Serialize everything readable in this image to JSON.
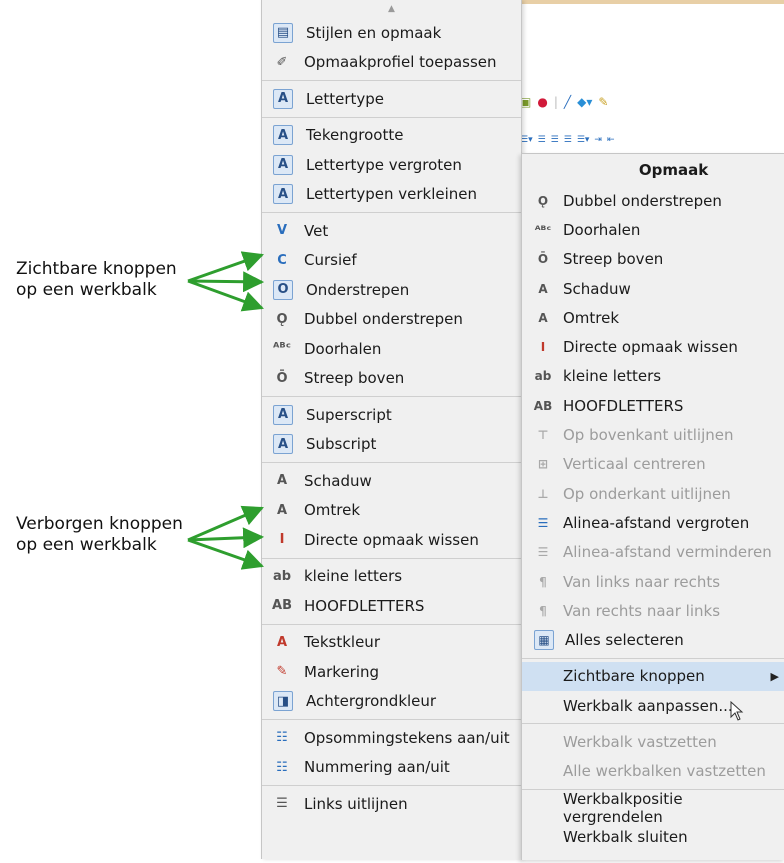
{
  "annotations": {
    "visible_line1": "Zichtbare knoppen",
    "visible_line2": "op een werkbalk",
    "hidden_line1": "Verborgen knoppen",
    "hidden_line2": "op een werkbalk"
  },
  "colors": {
    "arrow": "#2e9e2e",
    "highlight": "#cfe0f2",
    "disabled": "#9c9c9c"
  },
  "left_menu": {
    "groups": [
      [
        {
          "label": "Stijlen en opmaak",
          "icon": "styles-icon"
        },
        {
          "label": "Opmaakprofiel toepassen",
          "icon": "paintbrush-icon"
        }
      ],
      [
        {
          "label": "Lettertype",
          "icon": "font-name-icon"
        }
      ],
      [
        {
          "label": "Tekengrootte",
          "icon": "font-size-icon"
        },
        {
          "label": "Lettertype vergroten",
          "icon": "grow-font-icon"
        },
        {
          "label": "Lettertypen verkleinen",
          "icon": "shrink-font-icon"
        }
      ],
      [
        {
          "label": "Vet",
          "icon": "bold-icon"
        },
        {
          "label": "Cursief",
          "icon": "italic-icon"
        },
        {
          "label": "Onderstrepen",
          "icon": "underline-icon"
        },
        {
          "label": "Dubbel onderstrepen",
          "icon": "double-underline-icon"
        },
        {
          "label": "Doorhalen",
          "icon": "strikethrough-icon"
        },
        {
          "label": "Streep boven",
          "icon": "overline-icon"
        }
      ],
      [
        {
          "label": "Superscript",
          "icon": "superscript-icon"
        },
        {
          "label": "Subscript",
          "icon": "subscript-icon"
        }
      ],
      [
        {
          "label": "Schaduw",
          "icon": "shadow-icon"
        },
        {
          "label": "Omtrek",
          "icon": "outline-icon"
        },
        {
          "label": "Directe opmaak wissen",
          "icon": "clear-formatting-icon"
        }
      ],
      [
        {
          "label": "kleine letters",
          "icon": "lowercase-icon"
        },
        {
          "label": "HOOFDLETTERS",
          "icon": "uppercase-icon"
        }
      ],
      [
        {
          "label": "Tekstkleur",
          "icon": "font-color-icon"
        },
        {
          "label": "Markering",
          "icon": "highlight-icon"
        },
        {
          "label": "Achtergrondkleur",
          "icon": "background-color-icon"
        }
      ],
      [
        {
          "label": "Opsommingstekens aan/uit",
          "icon": "bullets-icon"
        },
        {
          "label": "Nummering aan/uit",
          "icon": "numbering-icon"
        }
      ],
      [
        {
          "label": "Links uitlijnen",
          "icon": "align-left-icon"
        }
      ]
    ]
  },
  "context_menu": {
    "title": "Opmaak",
    "items": [
      {
        "label": "Dubbel onderstrepen",
        "icon": "double-underline-icon",
        "disabled": false
      },
      {
        "label": "Doorhalen",
        "icon": "strikethrough-icon",
        "disabled": false
      },
      {
        "label": "Streep boven",
        "icon": "overline-icon",
        "disabled": false
      },
      {
        "label": "Schaduw",
        "icon": "shadow-icon",
        "disabled": false
      },
      {
        "label": "Omtrek",
        "icon": "outline-icon",
        "disabled": false
      },
      {
        "label": "Directe opmaak wissen",
        "icon": "clear-formatting-icon",
        "disabled": false
      },
      {
        "label": "kleine letters",
        "icon": "lowercase-icon",
        "disabled": false
      },
      {
        "label": "HOOFDLETTERS",
        "icon": "uppercase-icon",
        "disabled": false
      },
      {
        "label": "Op bovenkant uitlijnen",
        "icon": "align-top-icon",
        "disabled": true
      },
      {
        "label": "Verticaal centreren",
        "icon": "align-middle-icon",
        "disabled": true
      },
      {
        "label": "Op onderkant uitlijnen",
        "icon": "align-bottom-icon",
        "disabled": true
      },
      {
        "label": "Alinea-afstand vergroten",
        "icon": "increase-spacing-icon",
        "disabled": false
      },
      {
        "label": "Alinea-afstand verminderen",
        "icon": "decrease-spacing-icon",
        "disabled": true
      },
      {
        "label": "Van links naar rechts",
        "icon": "ltr-icon",
        "disabled": true
      },
      {
        "label": "Van rechts naar links",
        "icon": "rtl-icon",
        "disabled": true
      },
      {
        "label": "Alles selecteren",
        "icon": "select-all-icon",
        "disabled": false
      }
    ],
    "submenu_item": {
      "label": "Zichtbare knoppen"
    },
    "customize_item": {
      "label": "Werkbalk aanpassen..."
    },
    "dock_items": [
      {
        "label": "Werkbalk vastzetten",
        "disabled": true
      },
      {
        "label": "Alle werkbalken vastzetten",
        "disabled": true
      }
    ],
    "bottom_items": [
      {
        "label": "Werkbalkpositie vergrendelen",
        "disabled": false
      },
      {
        "label": "Werkbalk sluiten",
        "disabled": false
      }
    ]
  }
}
